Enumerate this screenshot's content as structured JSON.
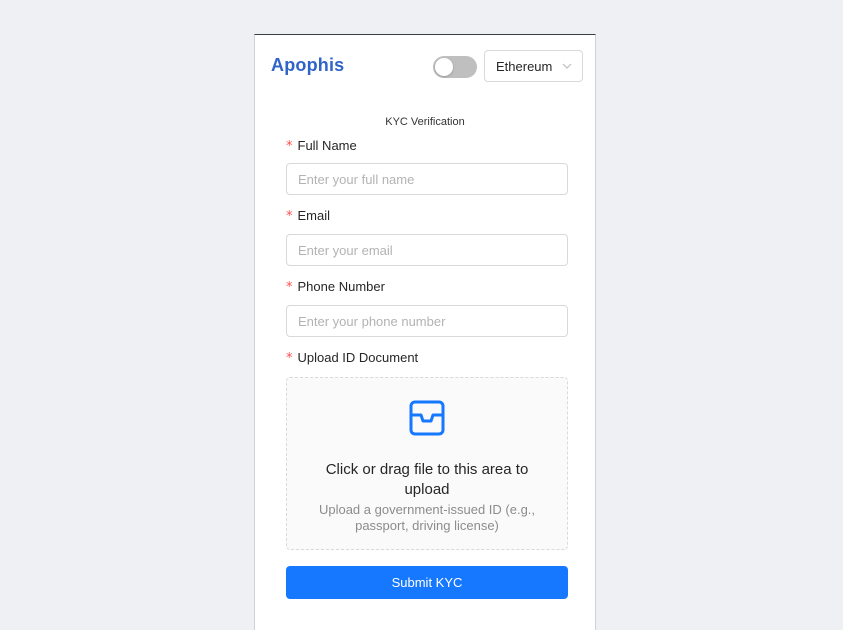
{
  "header": {
    "brand": "Apophis",
    "network_toggle": {
      "on": false
    },
    "network_select": {
      "value": "Ethereum"
    }
  },
  "form": {
    "title": "KYC Verification",
    "fields": {
      "full_name": {
        "label": "Full Name",
        "required_mark": "*",
        "placeholder": "Enter your full name",
        "value": ""
      },
      "email": {
        "label": "Email",
        "required_mark": "*",
        "placeholder": "Enter your email",
        "value": ""
      },
      "phone": {
        "label": "Phone Number",
        "required_mark": "*",
        "placeholder": "Enter your phone number",
        "value": ""
      },
      "upload": {
        "label": "Upload ID Document",
        "required_mark": "*"
      }
    },
    "upload": {
      "icon": "inbox-icon",
      "text": "Click or drag file to this area to upload",
      "hint": "Upload a government-issued ID (e.g., passport, driving license)"
    },
    "submit_label": "Submit KYC"
  },
  "colors": {
    "brand": "#2f64c9",
    "primary": "#1677ff",
    "required": "#ff4d4f",
    "background": "#eff0f4"
  }
}
